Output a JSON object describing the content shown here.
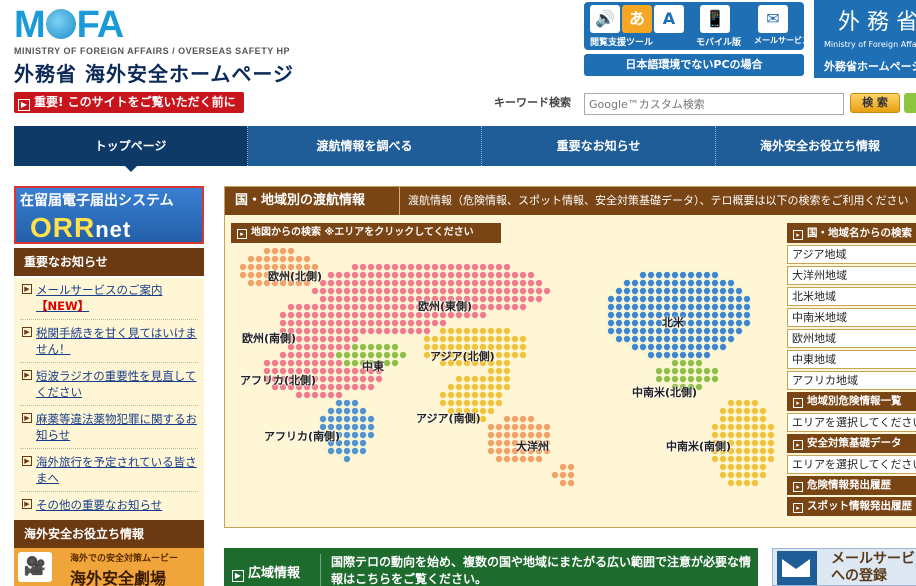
{
  "header": {
    "logo_left": "M",
    "logo_right": "FA",
    "logo_sub": "MINISTRY OF FOREIGN AFFAIRS / OVERSEAS SAFETY HP",
    "site_title": "外務省 海外安全ホームページ",
    "warning_button": "重要! このサイトをご覧いただく前に",
    "tools": [
      {
        "icon": "🔊",
        "label": "閲覧支援ツール"
      },
      {
        "icon": "📱",
        "label": "モバイル版"
      },
      {
        "icon": "✉",
        "label": "メールサービス"
      }
    ],
    "tool_note": "日本語環境でないPCの場合",
    "en_panel_big": "外 務 省",
    "en_panel_small": "Ministry of Foreign Affairs",
    "en_panel_jp": "外務省ホームページ",
    "keyword_label": "キーワード検索",
    "search_placeholder": "Google™カスタム検索",
    "search_button": "検 索"
  },
  "nav": {
    "items": [
      "トップページ",
      "渡航情報を調べる",
      "重要なお知らせ",
      "海外安全お役立ち情報"
    ]
  },
  "sidebar": {
    "orr_top": "在留届電子届出システム",
    "orr_big": "ORR",
    "orr_net": "net",
    "news_head": "重要なお知らせ",
    "news": [
      {
        "text": "メールサービスのご案内",
        "badge": "【NEW】"
      },
      {
        "text": "税関手続きを甘く見てはいけません！",
        "badge": ""
      },
      {
        "text": "短波ラジオの重要性を見直してください",
        "badge": ""
      },
      {
        "text": "麻薬等違法薬物犯罪に関するお知らせ",
        "badge": ""
      },
      {
        "text": "海外旅行を予定されている皆さまへ",
        "badge": ""
      },
      {
        "text": "その他の重要なお知らせ",
        "badge": ""
      }
    ],
    "useful_head": "海外安全お役立ち情報",
    "movie_small": "海外での安全対策ムービー",
    "movie_big": "海外安全劇場"
  },
  "main": {
    "title": "国・地域別の渡航情報",
    "desc": "渡航情報（危険情報、スポット情報、安全対策基礎データ）、テロ概要は以下の検索をご利用ください",
    "map_head": "地図からの検索 ※エリアをクリックしてください",
    "regions": [
      {
        "key": "eu_n",
        "label": "欧州(北側)",
        "color": "#f0a26a"
      },
      {
        "key": "eu_e",
        "label": "欧州(東側)",
        "color": "#ef7a8c"
      },
      {
        "key": "eu_s",
        "label": "欧州(南側)",
        "color": "#ef7a8c"
      },
      {
        "key": "me",
        "label": "中東",
        "color": "#8fbf4a"
      },
      {
        "key": "asia_n",
        "label": "アジア(北側)",
        "color": "#f2c23a"
      },
      {
        "key": "asia_s",
        "label": "アジア(南側)",
        "color": "#f2c23a"
      },
      {
        "key": "af_n",
        "label": "アフリカ(北側)",
        "color": "#ef7a8c"
      },
      {
        "key": "af_s",
        "label": "アフリカ(南側)",
        "color": "#4f93d1"
      },
      {
        "key": "oc",
        "label": "大洋州",
        "color": "#f0a26a"
      },
      {
        "key": "na",
        "label": "北米",
        "color": "#3f86d0"
      },
      {
        "key": "cam_n",
        "label": "中南米(北側)",
        "color": "#8fbf4a"
      },
      {
        "key": "cam_s",
        "label": "中南米(南側)",
        "color": "#f2c23a"
      }
    ],
    "list_head": "国・地域名からの検索",
    "areas": [
      "アジア地域",
      "大洋州地域",
      "北米地域",
      "中南米地域",
      "欧州地域",
      "中東地域",
      "アフリカ地域"
    ],
    "danger_head": "地域別危険情報一覧",
    "danger_select": "エリアを選択してください",
    "basic_head": "安全対策基礎データ",
    "basic_select": "エリアを選択してください",
    "danger_history": "危険情報発出履歴",
    "spot_history": "スポット情報発出履歴"
  },
  "bottom": {
    "wide_title": "広域情報",
    "wide_desc": "国際テロの動向を始め、複数の国や地域にまたがる広い範囲で注意が必要な情報はこちらをご覧ください。",
    "mail_line1": "メールサービ",
    "mail_line2": "への登録"
  }
}
